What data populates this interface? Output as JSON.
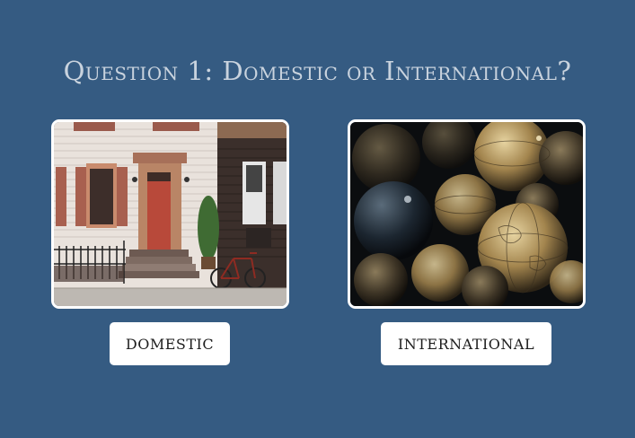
{
  "question": {
    "title": "Question 1: Domestic or International?"
  },
  "options": [
    {
      "label": "DOMESTIC",
      "image": "townhouse-street-with-bicycle"
    },
    {
      "label": "INTERNATIONAL",
      "image": "antique-globes"
    }
  ],
  "colors": {
    "background": "#355b82",
    "title": "#c9d3de",
    "button_bg": "#ffffff",
    "card_border": "#ffffff"
  }
}
